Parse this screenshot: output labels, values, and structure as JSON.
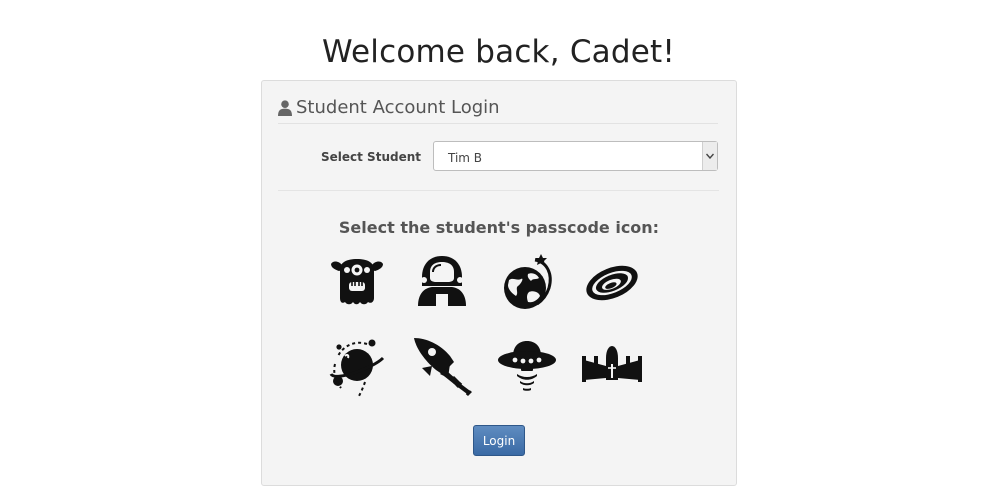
{
  "header": {
    "title": "Welcome back, Cadet!"
  },
  "panel": {
    "title": "Student Account Login",
    "icon": "user-icon"
  },
  "form": {
    "select_label": "Select Student",
    "select_value": "Tim B"
  },
  "prompt": "Select the student's passcode icon:",
  "passcode_icons": [
    "alien-monster-icon",
    "astronaut-helmet-icon",
    "planet-earth-icon",
    "galaxy-icon",
    "planet-orbit-icon",
    "rocket-icon",
    "ufo-icon",
    "starfighter-icon"
  ],
  "actions": {
    "login_label": "Login"
  },
  "colors": {
    "panel_bg": "#f4f4f4",
    "button_bg": "#3a6aa5",
    "icon_fill": "#111111"
  }
}
